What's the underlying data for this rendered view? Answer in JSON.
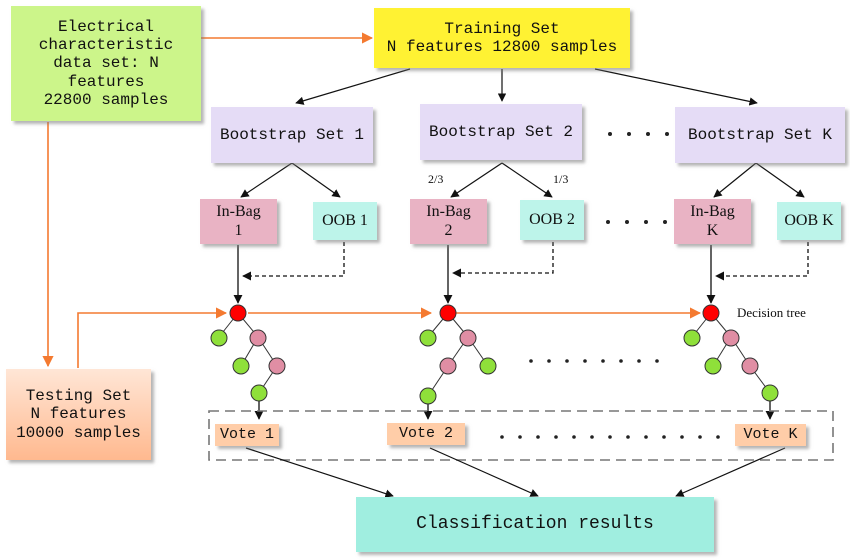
{
  "source": {
    "lines": [
      "Electrical",
      "characteristic",
      "data set: N",
      "features",
      "22800 samples"
    ]
  },
  "training": {
    "lines": [
      "Training Set",
      "N features 12800 samples"
    ]
  },
  "testing": {
    "lines": [
      "Testing Set",
      "N features",
      "10000 samples"
    ]
  },
  "bootstrap": [
    {
      "label": "Bootstrap Set 1"
    },
    {
      "label": "Bootstrap Set 2"
    },
    {
      "label": "Bootstrap Set K"
    }
  ],
  "inbag": [
    {
      "line1": "In-Bag",
      "line2": "1"
    },
    {
      "line1": "In-Bag",
      "line2": "2"
    },
    {
      "line1": "In-Bag",
      "line2": "K"
    }
  ],
  "oob": [
    {
      "label": "OOB 1"
    },
    {
      "label": "OOB 2"
    },
    {
      "label": "OOB K"
    }
  ],
  "fractions": {
    "inbag": "2/3",
    "oob": "1/3"
  },
  "decision_tree_label": "Decision tree",
  "votes": [
    {
      "label": "Vote 1"
    },
    {
      "label": "Vote 2"
    },
    {
      "label": "Vote K"
    }
  ],
  "result": {
    "label": "Classification results"
  },
  "colors": {
    "orange_arrow": "#f47a30",
    "root_node": "#ff0000",
    "leaf_node": "#8fe03a",
    "internal_node": "#e08ea4"
  }
}
